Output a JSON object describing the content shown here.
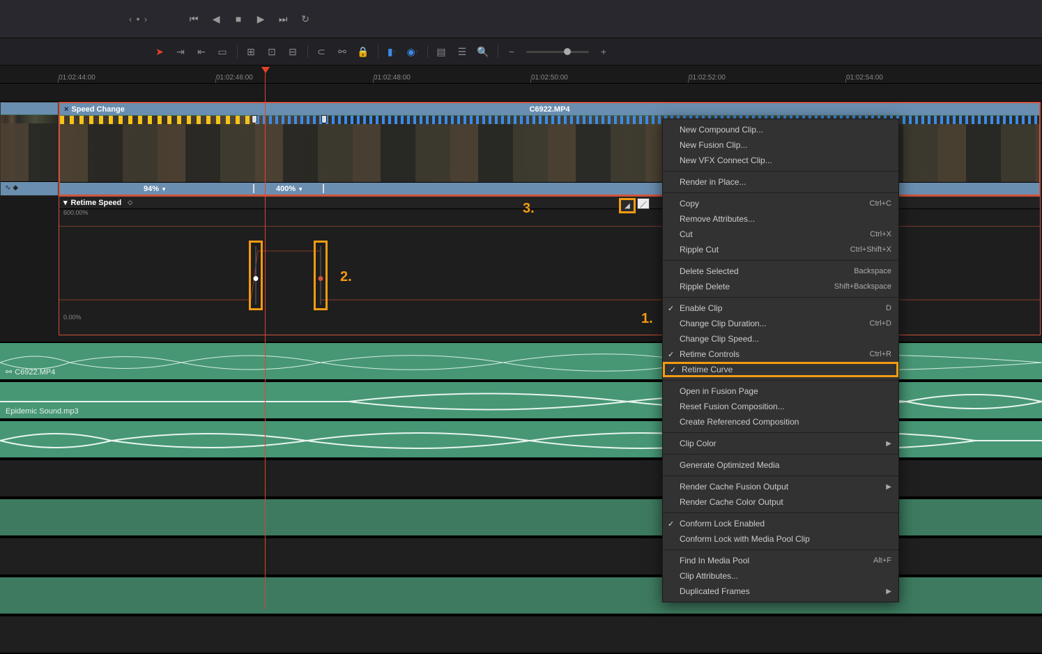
{
  "ruler_ticks": [
    {
      "label": "01:02:44:00",
      "pos": 84
    },
    {
      "label": "01:02:46:00",
      "pos": 310
    },
    {
      "label": "01:02:48:00",
      "pos": 536
    },
    {
      "label": "01:02:50:00",
      "pos": 762
    },
    {
      "label": "01:02:52:00",
      "pos": 988
    },
    {
      "label": "01:02:54:00",
      "pos": 1214
    }
  ],
  "clip": {
    "speed_change_label": "Speed Change",
    "filename": "C6922.MP4",
    "speeds": [
      {
        "value": "94%",
        "pos": 205
      },
      {
        "value": "400%",
        "pos": 400
      }
    ]
  },
  "retime": {
    "panel_label": "Retime Speed",
    "max_label": "600.00%",
    "min_label": "0.00%"
  },
  "audio": {
    "clip_label": "C6922.MP4",
    "music_label": "Epidemic Sound.mp3"
  },
  "annotations": {
    "n1": "1.",
    "n2": "2.",
    "n3": "3."
  },
  "menu": {
    "new_compound": "New Compound Clip...",
    "new_fusion": "New Fusion Clip...",
    "new_vfx": "New VFX Connect Clip...",
    "render_place": "Render in Place...",
    "copy": "Copy",
    "copy_k": "Ctrl+C",
    "remove_attr": "Remove Attributes...",
    "cut": "Cut",
    "cut_k": "Ctrl+X",
    "ripple_cut": "Ripple Cut",
    "ripple_cut_k": "Ctrl+Shift+X",
    "delete_sel": "Delete Selected",
    "delete_sel_k": "Backspace",
    "ripple_del": "Ripple Delete",
    "ripple_del_k": "Shift+Backspace",
    "enable_clip": "Enable Clip",
    "enable_clip_k": "D",
    "change_dur": "Change Clip Duration...",
    "change_dur_k": "Ctrl+D",
    "change_speed": "Change Clip Speed...",
    "retime_controls": "Retime Controls",
    "retime_controls_k": "Ctrl+R",
    "retime_curve": "Retime Curve",
    "open_fusion": "Open in Fusion Page",
    "reset_fusion": "Reset Fusion Composition...",
    "create_ref": "Create Referenced Composition",
    "clip_color": "Clip Color",
    "gen_opt": "Generate Optimized Media",
    "rcf": "Render Cache Fusion Output",
    "rcc": "Render Cache Color Output",
    "conform_lock": "Conform Lock Enabled",
    "conform_pool": "Conform Lock with Media Pool Clip",
    "find_pool": "Find In Media Pool",
    "find_pool_k": "Alt+F",
    "clip_attr": "Clip Attributes...",
    "dup_frames": "Duplicated Frames"
  }
}
